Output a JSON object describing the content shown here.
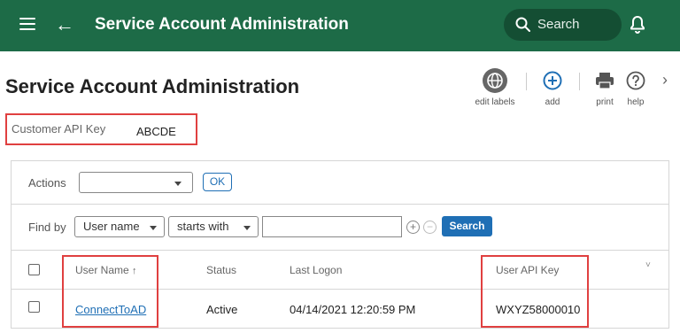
{
  "header": {
    "title": "Service Account Administration",
    "search_placeholder": "Search"
  },
  "page": {
    "title": "Service Account Administration"
  },
  "toolbar": {
    "edit_labels": "edit labels",
    "add": "add",
    "print": "print",
    "help": "help"
  },
  "customer": {
    "label": "Customer API Key",
    "value": "ABCDE"
  },
  "actions": {
    "label": "Actions",
    "selected": "",
    "ok_label": "OK"
  },
  "find": {
    "label": "Find by",
    "field": "User name",
    "operator": "starts with",
    "value": "",
    "search_label": "Search",
    "plus": "+",
    "minus": "−"
  },
  "table": {
    "columns": {
      "user_name": "User Name",
      "sort": "↑",
      "status": "Status",
      "last_logon": "Last Logon",
      "user_api_key": "User API Key",
      "menu": "˅"
    },
    "rows": [
      {
        "user_name": "ConnectToAD",
        "status": "Active",
        "last_logon": "04/14/2021 12:20:59 PM",
        "user_api_key": "WXYZ58000010"
      }
    ]
  },
  "colors": {
    "header_bg": "#1d6b47",
    "accent": "#1f6fb5",
    "highlight": "#e04040"
  },
  "icons": [
    "menu-icon",
    "back-arrow-icon",
    "search-icon",
    "bell-icon",
    "globe-icon",
    "add-circle-icon",
    "printer-icon",
    "help-icon",
    "chevron-right-icon",
    "caret-down-icon",
    "sort-up-icon"
  ]
}
